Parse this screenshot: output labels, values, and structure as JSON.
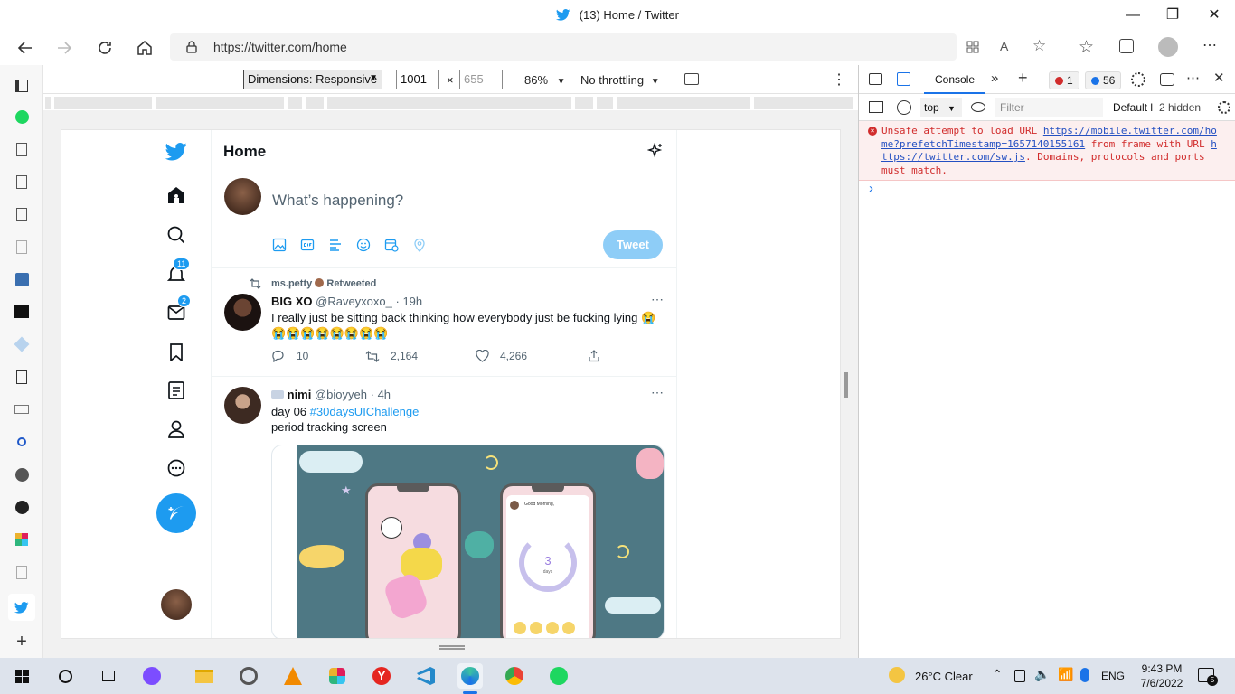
{
  "window": {
    "title": "(13) Home / Twitter",
    "minimize": "—",
    "maximize": "❐",
    "close": "✕"
  },
  "browser": {
    "url": "https://twitter.com/home"
  },
  "device_toolbar": {
    "dimensions": "Dimensions: Responsive",
    "width": "1001",
    "times": "×",
    "height": "655",
    "zoom": "86%",
    "throttling": "No throttling",
    "more": "⋮"
  },
  "twitter": {
    "header_title": "Home",
    "compose_placeholder": "What’s happening?",
    "tweet_button": "Tweet",
    "notifications_badge": "11",
    "messages_badge": "2",
    "tweets": [
      {
        "retweet_by": "ms.petty",
        "retweet_label": "Retweeted",
        "name": "BIG XO",
        "handle": "@Raveyxoxo_",
        "time": "· 19h",
        "text_line1": "I really just be sitting back thinking how everybody just be fucking lying 😭",
        "text_line2": "😭😭😭😭😭😭😭😭",
        "replies": "10",
        "retweets": "2,164",
        "likes": "4,266"
      },
      {
        "name": "nimi",
        "handle": "@bioyyeh",
        "time": "· 4h",
        "text_prefix": "day 06 ",
        "hashtag": "#30daysUIChallenge",
        "text_line2": "period tracking screen",
        "phone2_greeting": "Good Morning,",
        "phone2_days": "3",
        "phone2_days_label": "days"
      }
    ]
  },
  "devtools": {
    "console_tab": "Console",
    "errors_count": "1",
    "messages_count": "56",
    "context": "top",
    "filter_placeholder": "Filter",
    "levels": "Default l",
    "hidden": "2 hidden",
    "error_pre": "Unsafe attempt to load URL ",
    "error_url1_a": "https://mobile.twitter.com/ho",
    "error_url1_b": "me?prefetchTimestamp=1657140155161",
    "error_mid": " from frame with URL ",
    "error_url2_a": "h",
    "error_url2_b": "ttps://twitter.com/sw.js",
    "error_post": ". Domains, protocols and ports must match.",
    "prompt": "›"
  },
  "taskbar": {
    "weather": "26°C  Clear",
    "language": "ENG",
    "time": "9:43 PM",
    "date": "7/6/2022",
    "notifications": "5"
  },
  "colors": {
    "twitter_blue": "#1d9bf0",
    "error_red": "#d12c2c",
    "taskbar": "#dde3ec"
  }
}
